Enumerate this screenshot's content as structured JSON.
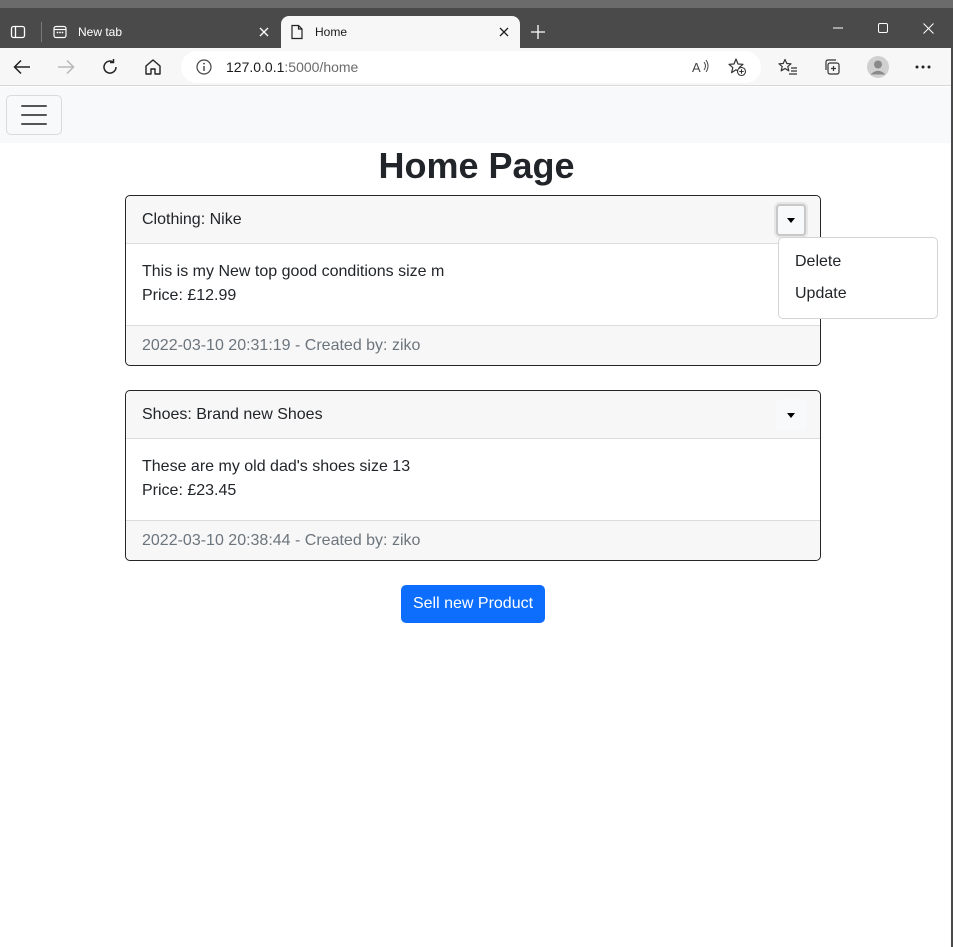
{
  "browser": {
    "tabs": [
      {
        "title": "New tab",
        "active": false,
        "icon": "newtab-icon"
      },
      {
        "title": "Home",
        "active": true,
        "icon": "page-icon"
      }
    ],
    "address": {
      "host": "127.0.0.1",
      "path": ":5000/home"
    },
    "colors": {
      "titlebar": "#4a4a4a",
      "toolbar": "#f7f7f7"
    }
  },
  "page": {
    "title": "Home Page",
    "products": [
      {
        "header": "Clothing: Nike",
        "description": "This is my New top good conditions size m",
        "price": "Price: £12.99",
        "footer": "2022-03-10 20:31:19 - Created by: ziko"
      },
      {
        "header": "Shoes: Brand new Shoes",
        "description": "These are my old dad's shoes size 13",
        "price": "Price: £23.45",
        "footer": "2022-03-10 20:38:44 - Created by: ziko"
      }
    ],
    "dropdown": {
      "items": [
        "Delete",
        "Update"
      ]
    },
    "sell_button": "Sell new Product",
    "colors": {
      "primary": "#0d6efd",
      "card_header": "#f7f7f7",
      "muted_text": "#6c757d"
    }
  }
}
